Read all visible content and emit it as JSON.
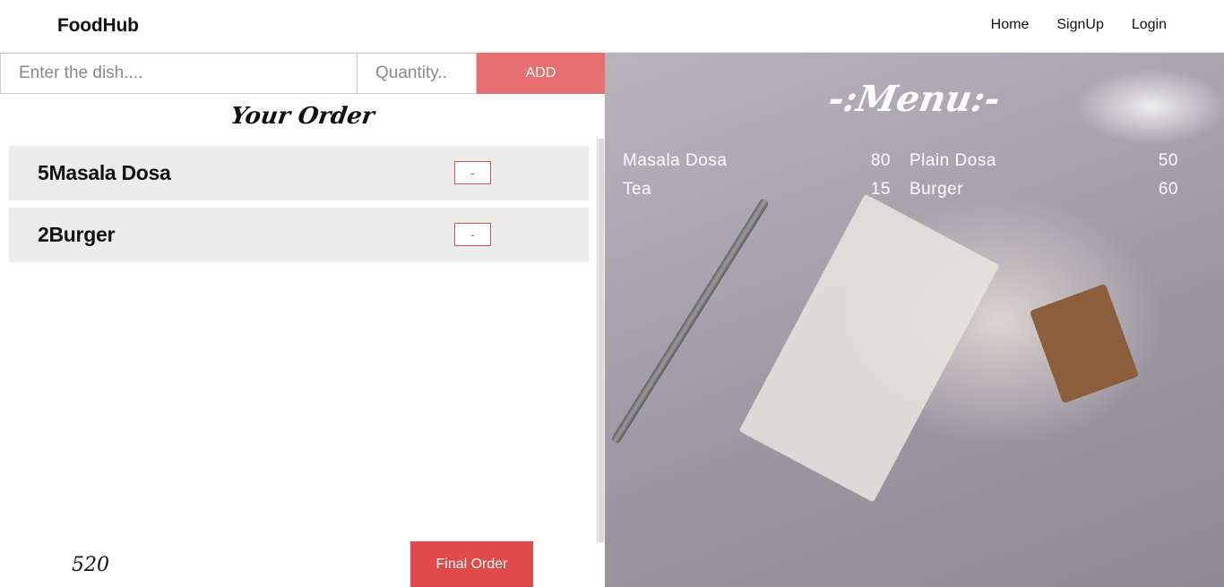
{
  "navbar": {
    "brand": "FoodHub",
    "links": [
      "Home",
      "SignUp",
      "Login"
    ]
  },
  "order_form": {
    "dish_placeholder": "Enter the dish....",
    "quantity_placeholder": "Quantity..",
    "add_label": "ADD"
  },
  "order": {
    "title": "Your Order",
    "items": [
      {
        "name": "5Masala Dosa",
        "remove_label": "-"
      },
      {
        "name": "2Burger",
        "remove_label": "-"
      }
    ],
    "total": "520",
    "final_label": "Final Order"
  },
  "menu": {
    "title": "-:Menu:-",
    "items": [
      {
        "name": "Masala Dosa",
        "price": "80"
      },
      {
        "name": "Plain Dosa",
        "price": "50"
      },
      {
        "name": "Tea",
        "price": "15"
      },
      {
        "name": "Burger",
        "price": "60"
      }
    ]
  }
}
